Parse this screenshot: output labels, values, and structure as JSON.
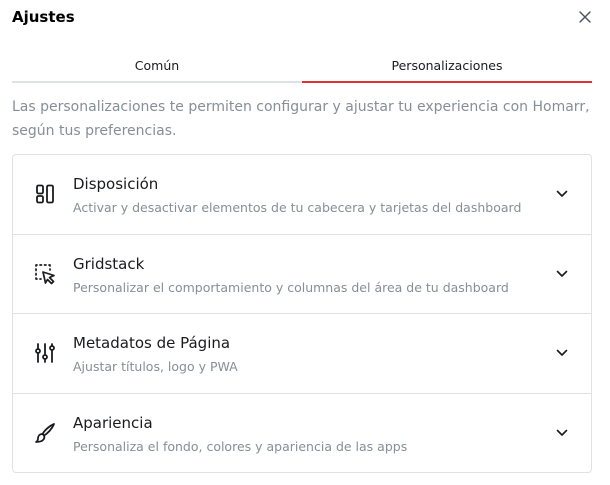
{
  "dialog": {
    "title": "Ajustes",
    "close_icon": "close-icon"
  },
  "tabs": [
    {
      "label": "Común",
      "active": false
    },
    {
      "label": "Personalizaciones",
      "active": true
    }
  ],
  "accent_color": "#e03131",
  "description": "Las personalizaciones te permiten configurar y ajustar tu experiencia con Homarr, según tus preferencias.",
  "sections": [
    {
      "icon": "layout-icon",
      "title": "Disposición",
      "subtitle": "Activar y desactivar elementos de tu cabecera y tarjetas del dashboard"
    },
    {
      "icon": "gridstack-drag-icon",
      "title": "Gridstack",
      "subtitle": "Personalizar el comportamiento y columnas del área de tu dashboard"
    },
    {
      "icon": "adjustments-icon",
      "title": "Metadatos de Página",
      "subtitle": "Ajustar títulos, logo y PWA"
    },
    {
      "icon": "brush-icon",
      "title": "Apariencia",
      "subtitle": "Personaliza el fondo, colores y apariencia de las apps"
    }
  ]
}
